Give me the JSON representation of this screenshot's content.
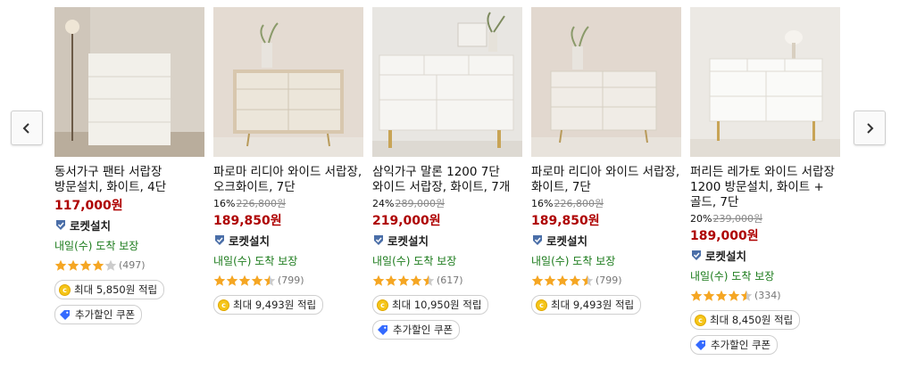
{
  "nav": {
    "prev_icon": "chevron-left-icon",
    "next_icon": "chevron-right-icon"
  },
  "colors": {
    "price": "#ae0000",
    "delivery": "#1a7a1a",
    "star": "#f5a623",
    "star_empty": "#cccccc",
    "coin": "#f5c518",
    "coupon": "#346aff"
  },
  "products": [
    {
      "title": "동서가구 팬타 서랍장 방문설치, 화이트, 4단",
      "discount": "",
      "original_price": "",
      "price": "117,000원",
      "badge": "로켓설치",
      "delivery": "내일(수) 도착 보장",
      "rating": 4.0,
      "reviews": "(497)",
      "reward": "최대 5,850원 적립",
      "coupon": "추가할인 쿠폰"
    },
    {
      "title": "파로마 리디아 와이드 서랍장, 오크화이트, 7단",
      "discount": "16%",
      "original_price": "226,800원",
      "price": "189,850원",
      "badge": "로켓설치",
      "delivery": "내일(수) 도착 보장",
      "rating": 4.5,
      "reviews": "(799)",
      "reward": "최대 9,493원 적립",
      "coupon": ""
    },
    {
      "title": "삼익가구 말론 1200 7단 와이드 서랍장, 화이트, 7개",
      "discount": "24%",
      "original_price": "289,000원",
      "price": "219,000원",
      "badge": "로켓설치",
      "delivery": "내일(수) 도착 보장",
      "rating": 4.5,
      "reviews": "(617)",
      "reward": "최대 10,950원 적립",
      "coupon": "추가할인 쿠폰"
    },
    {
      "title": "파로마 리디아 와이드 서랍장, 화이트, 7단",
      "discount": "16%",
      "original_price": "226,800원",
      "price": "189,850원",
      "badge": "로켓설치",
      "delivery": "내일(수) 도착 보장",
      "rating": 4.5,
      "reviews": "(799)",
      "reward": "최대 9,493원 적립",
      "coupon": ""
    },
    {
      "title": "퍼리든 레가토 와이드 서랍장 1200 방문설치, 화이트 + 골드, 7단",
      "discount": "20%",
      "original_price": "239,000원",
      "price": "189,000원",
      "badge": "로켓설치",
      "delivery": "내일(수) 도착 보장",
      "rating": 4.5,
      "reviews": "(334)",
      "reward": "최대 8,450원 적립",
      "coupon": "추가할인 쿠폰"
    }
  ]
}
